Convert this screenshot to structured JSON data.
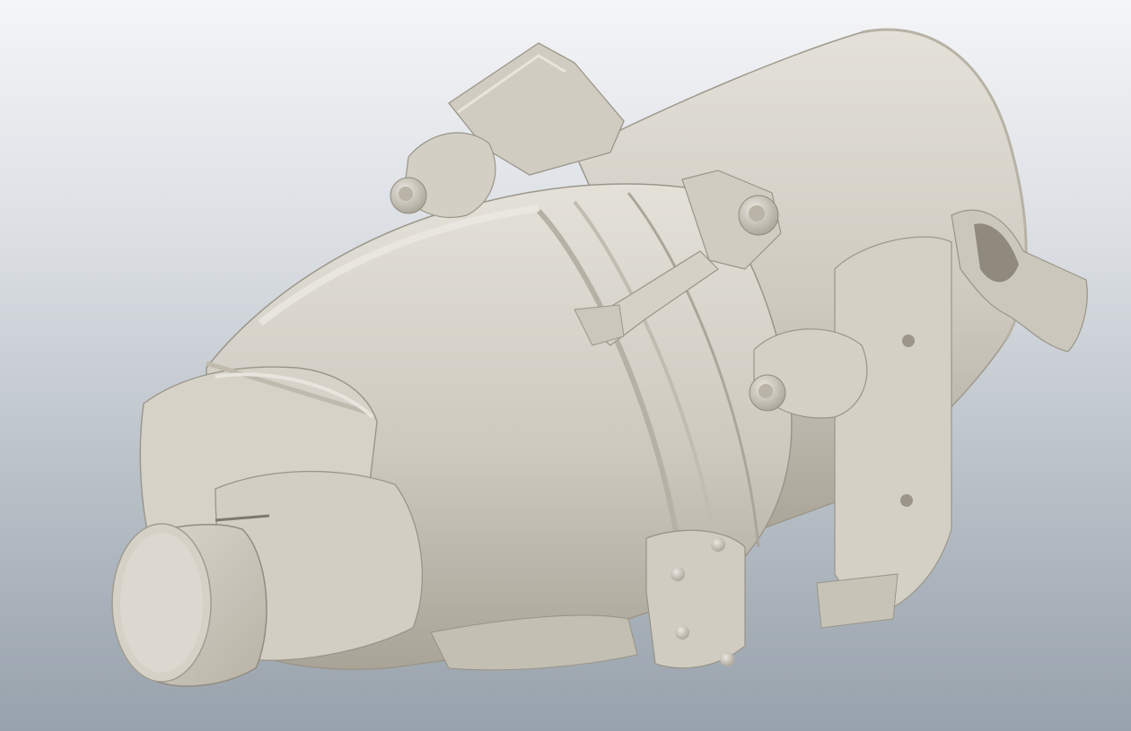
{
  "viewer": {
    "background_top": "#f4f5f7",
    "background_bottom": "#98a2ac"
  },
  "model": {
    "subject": "3d-scanned-gearbox-transmission",
    "surface_color": "#d2cec4",
    "shade_color": "#aaa598",
    "highlight_color": "#e6e3dc"
  }
}
